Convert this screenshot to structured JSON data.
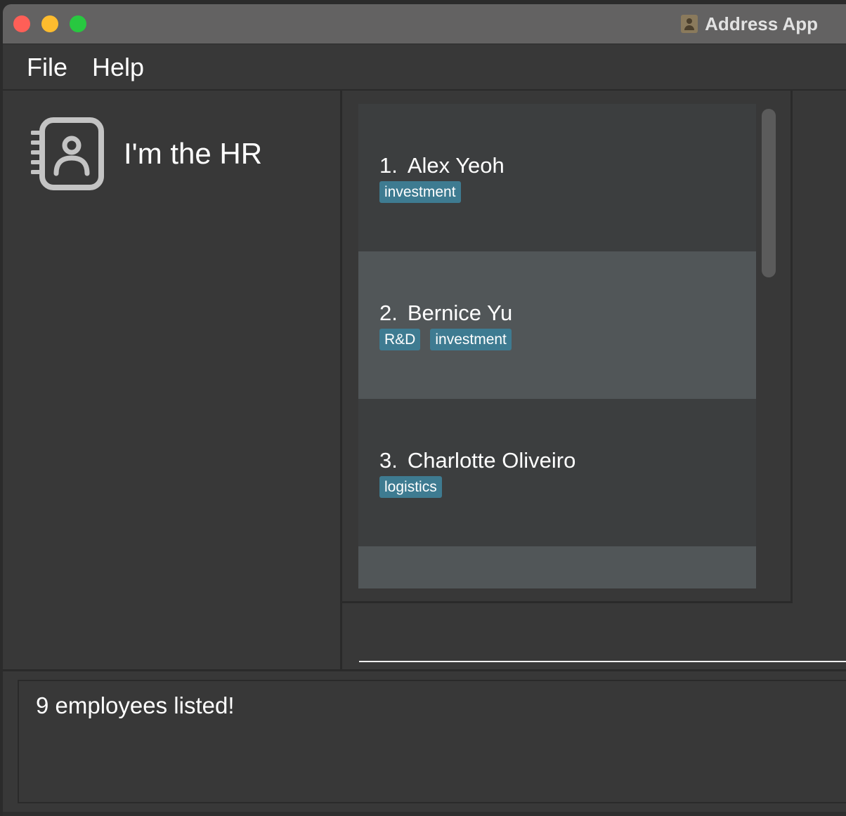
{
  "window": {
    "title": "Address App"
  },
  "menu": {
    "file": "File",
    "help": "Help"
  },
  "sidebar": {
    "label": "I'm the HR"
  },
  "persons": [
    {
      "index": "1.",
      "name": "Alex Yeoh",
      "tags": [
        "investment"
      ]
    },
    {
      "index": "2.",
      "name": "Bernice Yu",
      "tags": [
        "R&D",
        "investment"
      ]
    },
    {
      "index": "3.",
      "name": "Charlotte Oliveiro",
      "tags": [
        "logistics"
      ]
    }
  ],
  "command": {
    "value": ""
  },
  "result": {
    "message": "9 employees listed!"
  },
  "colors": {
    "tag": "#3e7b91",
    "card_dark": "#3c3e3f",
    "card_light": "#515658",
    "background": "#383838"
  }
}
